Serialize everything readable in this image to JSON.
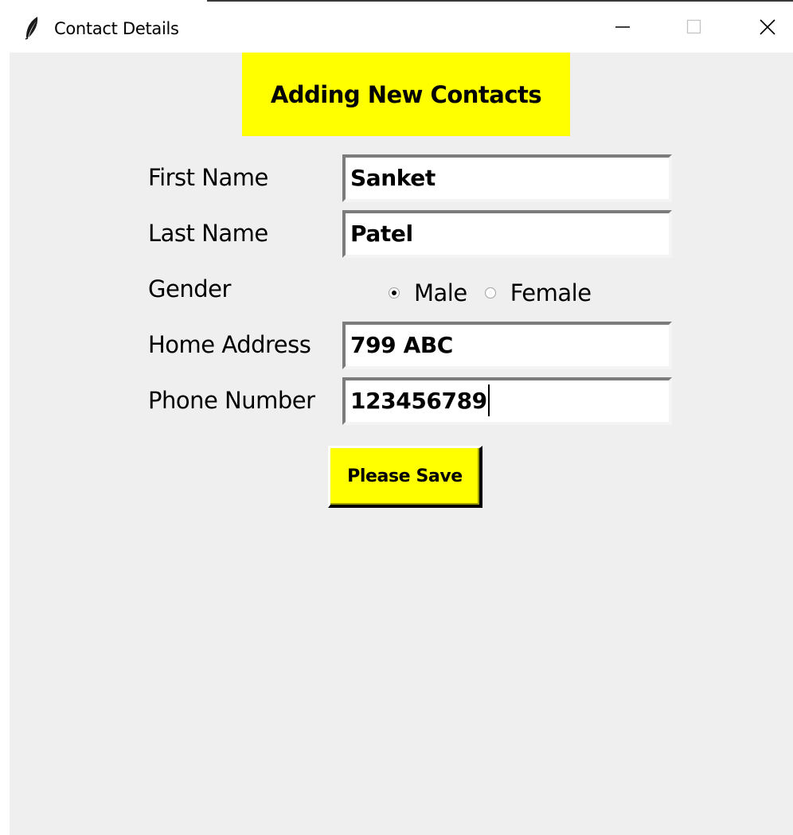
{
  "window": {
    "title": "Contact Details",
    "app_icon": "feather-icon",
    "controls": {
      "minimize_icon": "minimize-icon",
      "maximize_icon": "maximize-icon",
      "close_icon": "close-icon"
    }
  },
  "form": {
    "heading": "Adding New Contacts",
    "heading_bg": "#ffff00",
    "background": "#efefef",
    "first_name": {
      "label": "First Name",
      "value": "Sanket"
    },
    "last_name": {
      "label": "Last Name",
      "value": "Patel"
    },
    "gender": {
      "label": "Gender",
      "options": [
        {
          "label": "Male",
          "selected": true
        },
        {
          "label": "Female",
          "selected": false
        }
      ]
    },
    "home_address": {
      "label": "Home Address",
      "value": "799 ABC"
    },
    "phone_number": {
      "label": "Phone Number",
      "value": "123456789"
    },
    "save_button": {
      "label": "Please Save",
      "bg": "#ffff00"
    }
  }
}
